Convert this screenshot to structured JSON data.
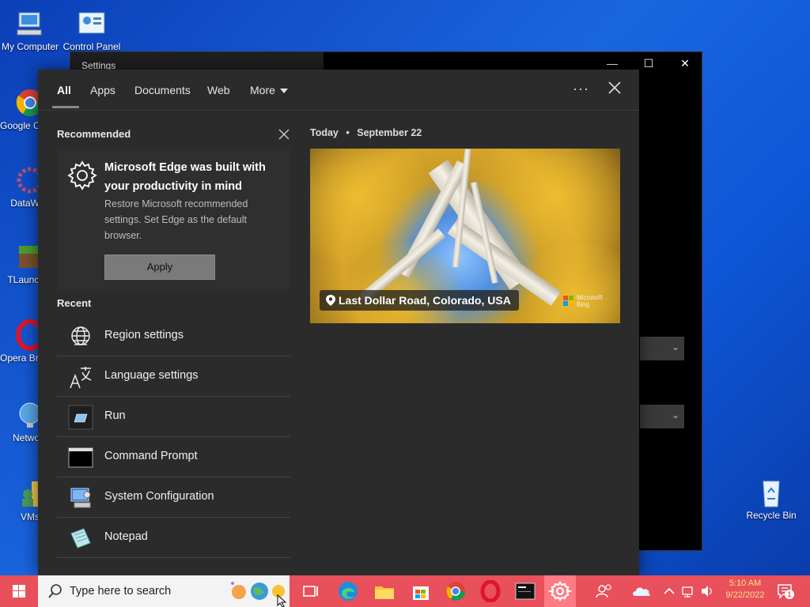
{
  "desktop": {
    "icons": [
      {
        "label": "My Computer"
      },
      {
        "label": "Control Panel"
      },
      {
        "label": "Google Chrome"
      },
      {
        "label": "DataWag"
      },
      {
        "label": "TLauncher"
      },
      {
        "label": "Opera Browser"
      },
      {
        "label": "Network"
      },
      {
        "label": "VMs"
      },
      {
        "label": "Recycle Bin"
      }
    ]
  },
  "settings_window": {
    "title": "Settings",
    "minimize": "—",
    "maximize": "☐",
    "close": "✕"
  },
  "search": {
    "tabs": [
      {
        "label": "All"
      },
      {
        "label": "Apps"
      },
      {
        "label": "Documents"
      },
      {
        "label": "Web"
      },
      {
        "label": "More"
      }
    ],
    "more_dots": "···",
    "recommended": {
      "heading": "Recommended",
      "title": "Microsoft Edge was built with your productivity in mind",
      "description": "Restore Microsoft recommended settings. Set Edge as the default browser.",
      "button": "Apply"
    },
    "recent": {
      "heading": "Recent",
      "items": [
        {
          "label": "Region settings",
          "icon": "globe-icon"
        },
        {
          "label": "Language settings",
          "icon": "language-icon"
        },
        {
          "label": "Run",
          "icon": "run-icon"
        },
        {
          "label": "Command Prompt",
          "icon": "cmd-icon"
        },
        {
          "label": "System Configuration",
          "icon": "sysconfig-icon"
        },
        {
          "label": "Notepad",
          "icon": "notepad-icon"
        }
      ]
    },
    "today": {
      "label": "Today",
      "separator": "•",
      "date": "September 22",
      "image_caption": "Last Dollar Road, Colorado, USA",
      "bing_text_1": "Microsoft",
      "bing_text_2": "Bing"
    }
  },
  "taskbar": {
    "search_placeholder": "Type here to search",
    "time": "5:10 AM",
    "date": "9/22/2022",
    "notification_count": "1",
    "accent_color": "#e8505b"
  }
}
